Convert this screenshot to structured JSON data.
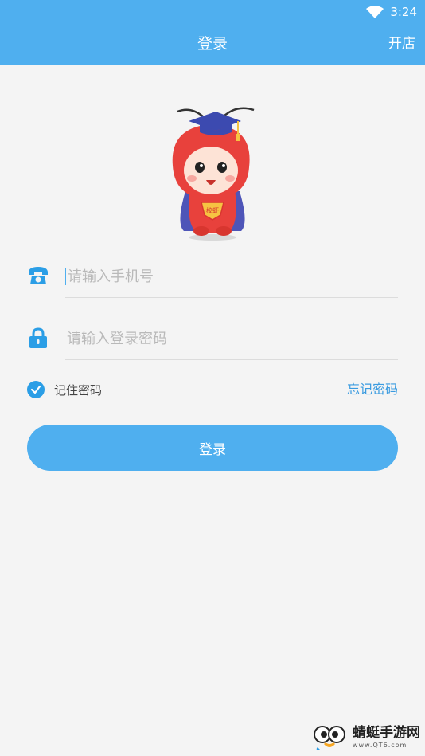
{
  "status_bar": {
    "time": "3:24",
    "wifi_icon": "wifi-icon"
  },
  "header": {
    "title": "登录",
    "right_action": "开店"
  },
  "mascot": {
    "badge_text": "校虾",
    "icon": "mascot-shrimp-graduate"
  },
  "form": {
    "phone_placeholder": "请输入手机号",
    "phone_value": "",
    "phone_icon": "telephone-icon",
    "password_placeholder": "请输入登录密码",
    "password_value": "",
    "password_icon": "lock-icon",
    "remember_label": "记住密码",
    "remember_checked": true,
    "forgot_label": "忘记密码",
    "submit_label": "登录"
  },
  "watermark": {
    "name": "蜻蜓手游网",
    "url": "www.QT6.com"
  },
  "colors": {
    "accent": "#4fafef",
    "background": "#f4f4f4",
    "link": "#3a9be0",
    "mascot_red": "#e8413c"
  }
}
